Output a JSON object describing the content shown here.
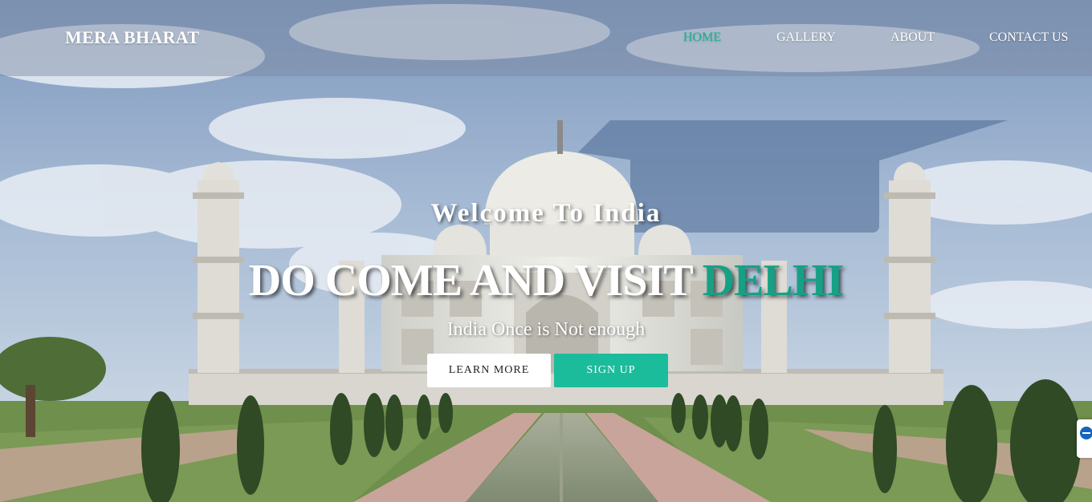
{
  "brand": "MERA BHARAT",
  "nav": {
    "home": "HOME",
    "gallery": "GALLERY",
    "about": "ABOUT",
    "contact": "CONTACT US"
  },
  "hero": {
    "welcome": "Welcome To India",
    "headline_main": "DO COME AND VISIT ",
    "headline_accent": "DELHI",
    "tagline": "India Once is Not enough",
    "learn_more": "LEARN MORE",
    "sign_up": "SIGN UP"
  },
  "colors": {
    "accent": "#1abc9c",
    "nav_active": "#1ab394",
    "headline_accent": "#16a085"
  },
  "icons": {
    "side_widget": "chat-widget-icon"
  }
}
